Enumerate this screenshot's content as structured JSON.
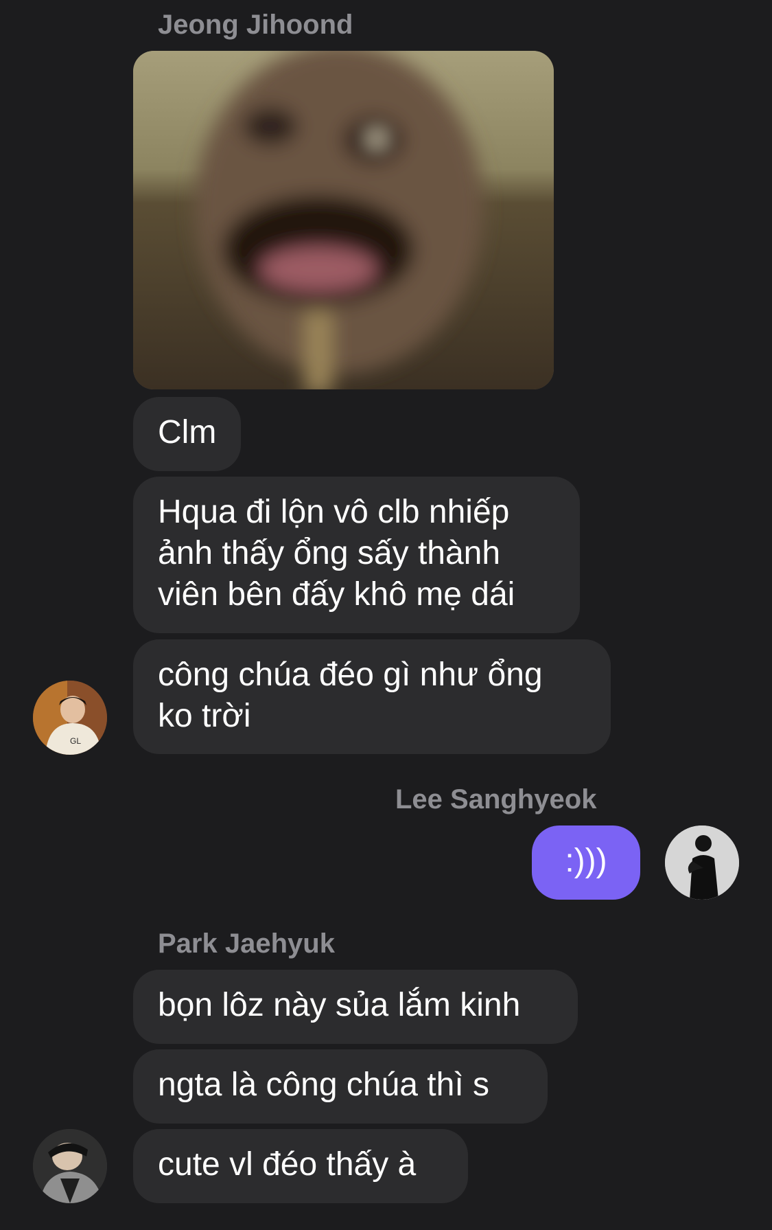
{
  "messages": {
    "group1": {
      "sender": "Jeong Jihoond",
      "bubbles": [
        "Clm",
        [
          "Hqua đi lộn vô clb nhiếp",
          "ảnh thấy ổng sấy thành",
          "viên bên đấy khô mẹ dái"
        ],
        [
          "công chúa đéo gì như ổng",
          "ko trời"
        ]
      ]
    },
    "group2": {
      "sender": "Lee Sanghyeok",
      "bubbles": [
        ":)))"
      ]
    },
    "group3": {
      "sender": "Park Jaehyuk",
      "bubbles": [
        "bọn lôz này sủa lắm kinh",
        "ngta là công chúa thì s",
        "cute vl đéo thấy à"
      ]
    }
  },
  "colors": {
    "background": "#1c1c1e",
    "incoming_bubble": "#2c2c2e",
    "outgoing_bubble": "#7b63f4",
    "sender_name": "#8e8e93"
  },
  "icons": {
    "photo": "blurred-face-photo",
    "avatar1": "user-avatar-jeong",
    "avatar2": "user-avatar-lee",
    "avatar3": "user-avatar-park"
  }
}
